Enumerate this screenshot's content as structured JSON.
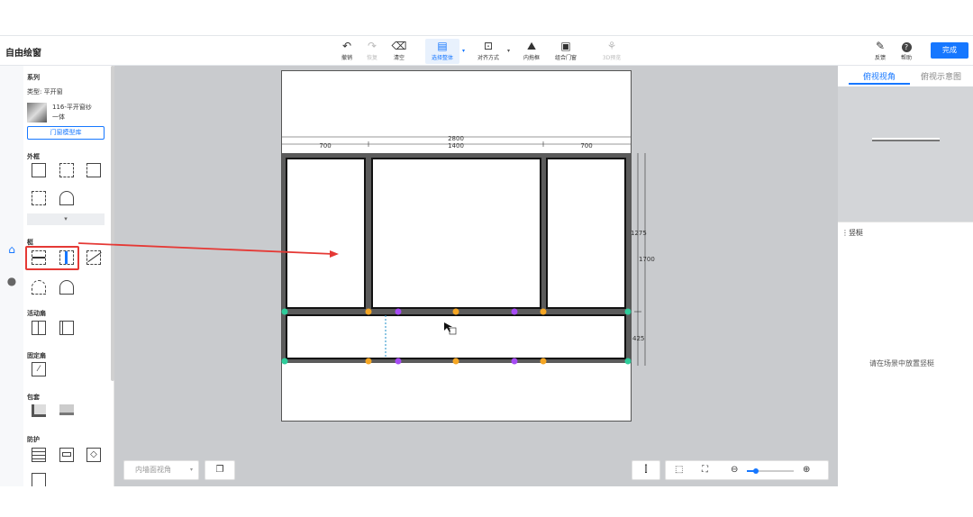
{
  "app": {
    "title": "自由绘窗"
  },
  "toolbar": {
    "items": [
      {
        "label": "撤销",
        "icon": "undo-icon",
        "glyph": "↶"
      },
      {
        "label": "恢复",
        "icon": "redo-icon",
        "glyph": "↷"
      },
      {
        "label": "清空",
        "icon": "eraser-icon",
        "glyph": "⌫"
      },
      {
        "label": "选择整体",
        "icon": "select-all-icon",
        "glyph": "▤"
      },
      {
        "label": "对齐方式",
        "icon": "align-icon",
        "glyph": "⊡"
      },
      {
        "label": "内拖框",
        "icon": "inner-drag-icon",
        "glyph": "⛰"
      },
      {
        "label": "组合门窗",
        "icon": "combine-window-icon",
        "glyph": "▣"
      },
      {
        "label": "3D预览",
        "icon": "3d-preview-icon",
        "glyph": "⚘"
      }
    ],
    "feedback_label": "反馈",
    "help_label": "帮助",
    "done_label": "完成"
  },
  "left_panel": {
    "series_title": "系列",
    "type_label": "类型: 平开窗",
    "model_name_line1": "116-平开窗纱",
    "model_name_line2": "一体",
    "library_button": "门窗模型库",
    "frame_title": "外框",
    "mullion_title": "梃",
    "active_sash_title": "活动扇",
    "fixed_sash_title": "固定扇",
    "wrap_title": "包套",
    "guard_title": "防护"
  },
  "drawing": {
    "dim_total": "2800",
    "dim_middle": "1400",
    "dim_left": "700",
    "dim_right": "700",
    "dim_upper": "1275",
    "dim_total_height": "1700",
    "dim_lower": "425"
  },
  "right_panel": {
    "tab_top_view": "俯视视角",
    "tab_top_diagram": "俯视示意图",
    "section_title": "竖梃",
    "hint": "请在场景中放置竖梃"
  },
  "bottom": {
    "view_select": "内墙面视角",
    "zoom_level": 0.2
  },
  "colors": {
    "accent": "#1677ff",
    "highlight": "#e53935",
    "handle_orange": "#f5a623",
    "handle_purple": "#a64bf4",
    "handle_green": "#2ecc9a"
  }
}
